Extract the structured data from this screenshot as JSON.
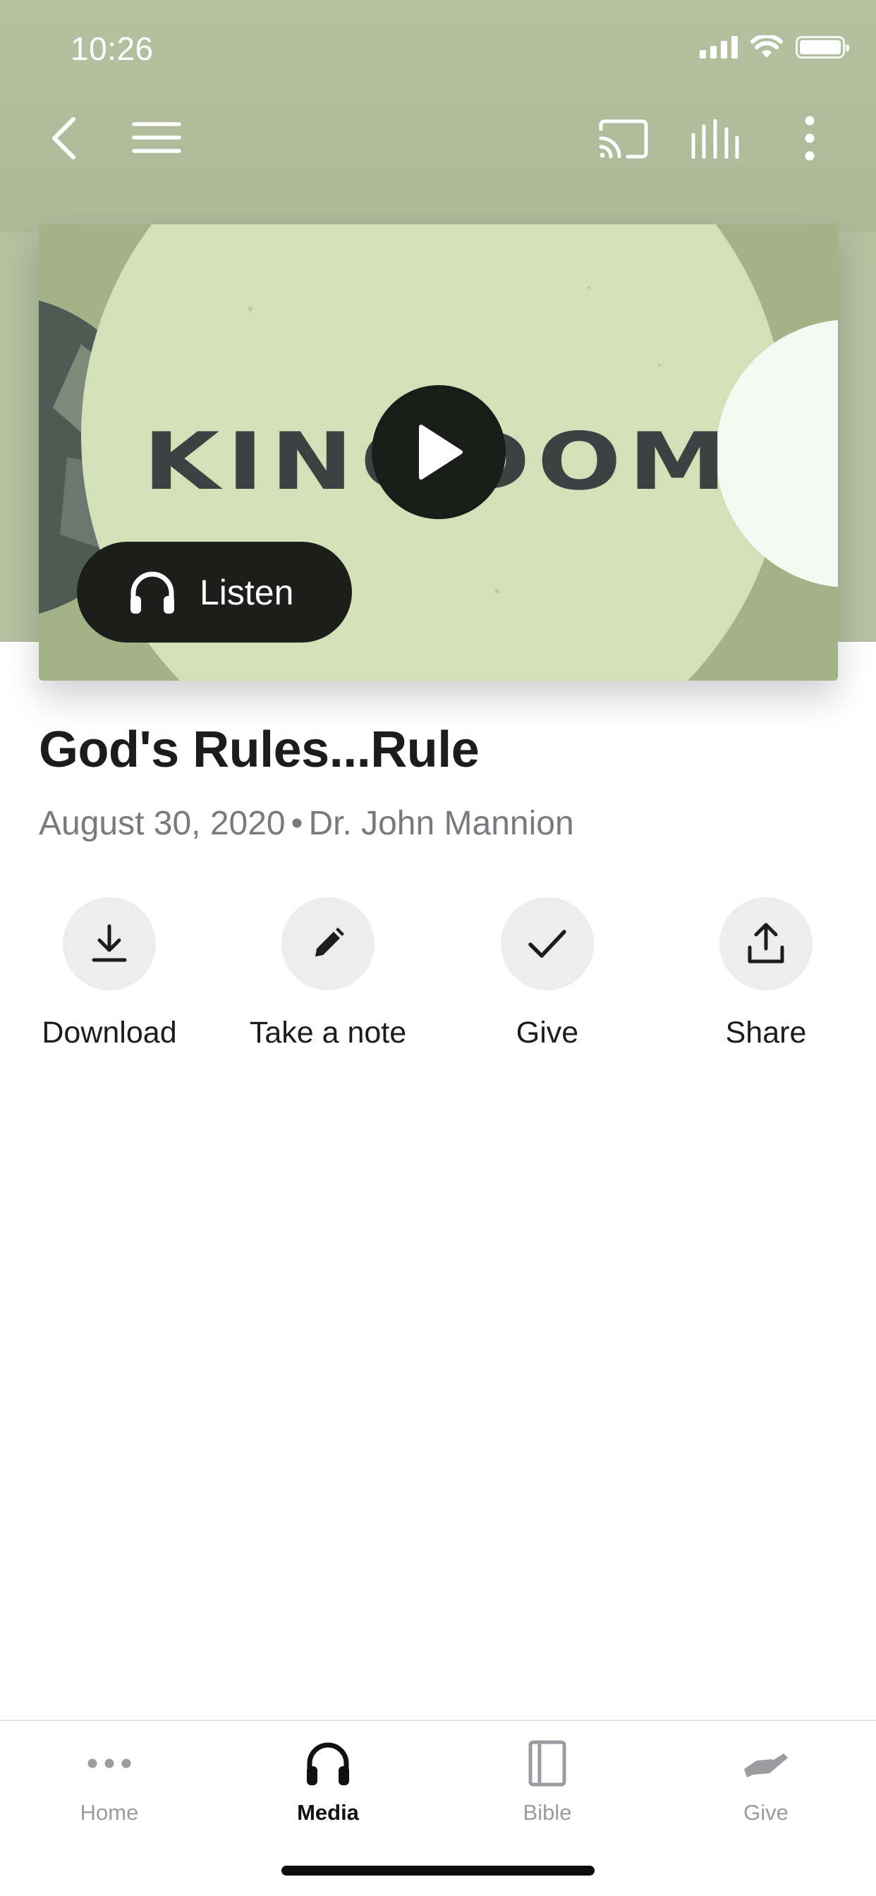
{
  "status_bar": {
    "time": "10:26"
  },
  "toolbar": {
    "icons": [
      "back-icon",
      "menu-icon",
      "cast-icon",
      "equalizer-icon",
      "more-vertical-icon"
    ]
  },
  "media": {
    "artwork_text": "KINGDOM",
    "listen_label": "Listen",
    "play_icon": "play-icon",
    "headphones_icon": "headphones-icon"
  },
  "sermon": {
    "title": "God's Rules...Rule",
    "date": "August 30, 2020",
    "separator": "•",
    "speaker": "Dr. John Mannion"
  },
  "actions": [
    {
      "label": "Download",
      "icon": "download-icon"
    },
    {
      "label": "Take a note",
      "icon": "pencil-icon"
    },
    {
      "label": "Give",
      "icon": "checkmark-icon"
    },
    {
      "label": "Share",
      "icon": "share-icon"
    }
  ],
  "tabs": [
    {
      "label": "Home",
      "icon": "ellipsis-icon",
      "active": false
    },
    {
      "label": "Media",
      "icon": "headphones-icon",
      "active": true
    },
    {
      "label": "Bible",
      "icon": "book-icon",
      "active": false
    },
    {
      "label": "Give",
      "icon": "giving-hand-icon",
      "active": false
    }
  ],
  "colors": {
    "header_background": "#b4c0a0",
    "artwork_light": "#d3e0b8",
    "dark_button": "#1d1e1c",
    "action_circle": "#ededee",
    "secondary_text": "#7a7a7e",
    "inactive_tab": "#9b9ba0"
  }
}
